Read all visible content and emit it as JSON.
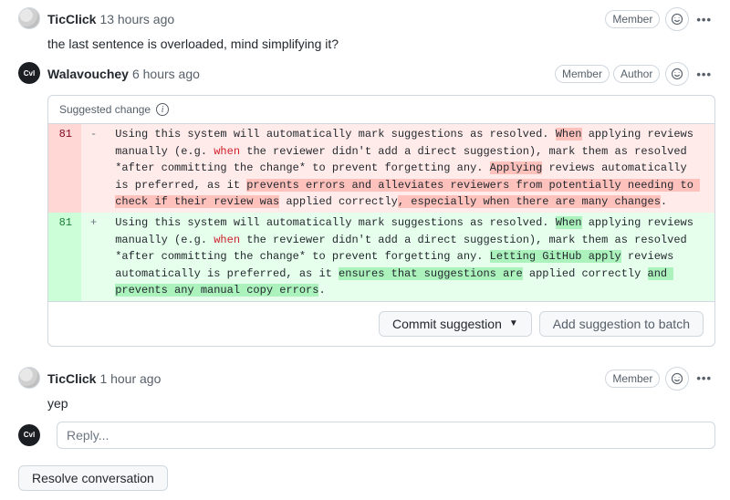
{
  "comments": [
    {
      "author": "TicClick",
      "timestamp": "13 hours ago",
      "badges": [
        "Member"
      ],
      "body": "the last sentence is overloaded, mind simplifying it?"
    },
    {
      "author": "Walavouchey",
      "timestamp": "6 hours ago",
      "badges": [
        "Member",
        "Author"
      ],
      "body": "",
      "suggestion_label": "Suggested change",
      "diff": {
        "del_lineno": "81",
        "add_lineno": "81",
        "del_marker": "-",
        "add_marker": "+",
        "del": {
          "p1": "Using this system will automatically mark suggestions as resolved. ",
          "h1": "When",
          "p2": " applying reviews manually (e.g. ",
          "kw": "when",
          "p3": " the reviewer didn't add a direct suggestion), mark them as resolved *after committing the change* to prevent forgetting any. ",
          "h2": "Applying",
          "p4": " reviews automatically is preferred, as it ",
          "h3": "prevents errors and alleviates reviewers from potentially needing to check if their review was",
          "p5": " applied correctly",
          "h4": ", especially when there are many changes",
          "p6": "."
        },
        "add": {
          "p1": "Using this system will automatically mark suggestions as resolved. ",
          "h1": "When",
          "p2": " applying reviews manually (e.g. ",
          "kw": "when",
          "p3": " the reviewer didn't add a direct suggestion), mark them as resolved *after committing the change* to prevent forgetting any. ",
          "h2": "Letting GitHub apply",
          "p4": " reviews automatically is preferred, as it ",
          "h3": "ensures that suggestions are",
          "p5": " applied correctly ",
          "h4": "and prevents any manual copy errors",
          "p6": "."
        }
      },
      "commit_btn": "Commit suggestion",
      "add_batch_btn": "Add suggestion to batch"
    },
    {
      "author": "TicClick",
      "timestamp": "1 hour ago",
      "badges": [
        "Member"
      ],
      "body": "yep"
    }
  ],
  "reply_placeholder": "Reply...",
  "resolve_btn": "Resolve conversation"
}
